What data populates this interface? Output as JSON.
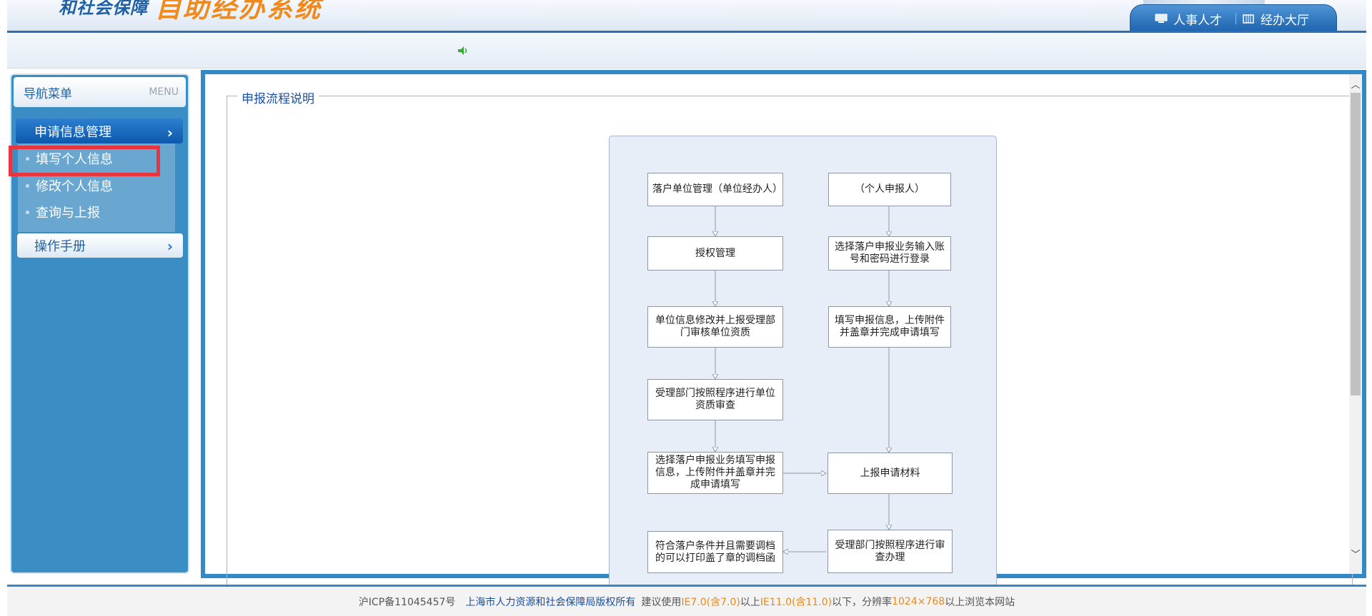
{
  "header": {
    "logo_sub": "和社会保障",
    "logo_main": "自助经办系统",
    "tabs": [
      {
        "label": "人事人才",
        "icon": "monitor-icon"
      },
      {
        "label": "经办大厅",
        "icon": "building-icon"
      }
    ]
  },
  "sidebar": {
    "title": "导航菜单",
    "menu_label": "MENU",
    "section1": {
      "label": "申请信息管理",
      "arrow": "›"
    },
    "items": [
      {
        "label": "填写个人信息"
      },
      {
        "label": "修改个人信息"
      },
      {
        "label": "查询与上报"
      }
    ],
    "section2": {
      "label": "操作手册",
      "arrow": "›"
    }
  },
  "content": {
    "legend": "申报流程说明",
    "flow": {
      "left": [
        "落户单位管理（单位经办人）",
        "授权管理",
        "单位信息修改并上报受理部门审核单位资质",
        "受理部门按照程序进行单位资质审查",
        "选择落户申报业务填写申报信息，上传附件并盖章并完成申请填写",
        "符合落户条件并且需要调档的可以打印盖了章的调档函"
      ],
      "right": [
        "（个人申报人）",
        "选择落户申报业务输入账号和密码进行登录",
        "填写申报信息，上传附件并盖章并完成申请填写",
        "上报申请材料",
        "受理部门按照程序进行审查办理"
      ]
    },
    "scroll_up": "︿",
    "scroll_down": "﹀"
  },
  "footer": {
    "icp": "沪ICP备11045457号",
    "copyright": "上海市人力资源和社会保障局版权所有",
    "t1": "建议使用",
    "ie_low": "IE7.0(含7.0)",
    "t2": "以上",
    "ie_high": "IE11.0(含11.0)",
    "t3": "以下，分辨率",
    "resolution": "1024×768",
    "t4": "以上浏览本网站"
  },
  "colors": {
    "accent": "#3389c6",
    "sidebar": "#3a8ec3",
    "highlight": "#e8353e",
    "logo_orange": "#f08a1c"
  }
}
